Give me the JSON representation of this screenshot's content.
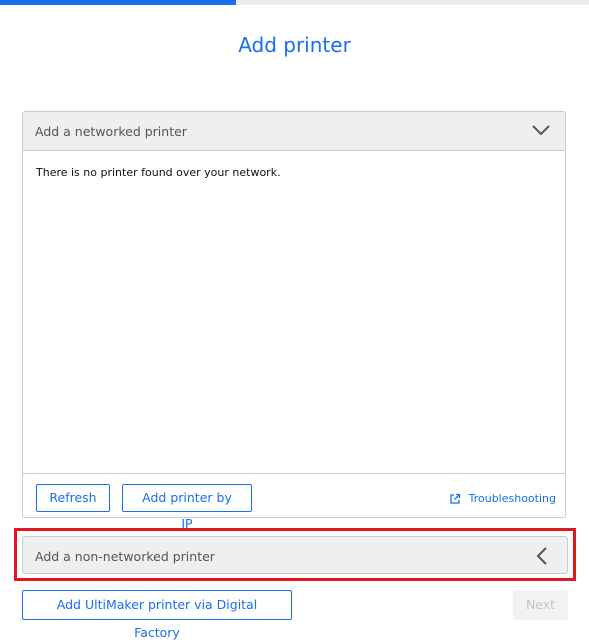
{
  "progress": {
    "fraction": 0.4
  },
  "title": "Add printer",
  "networked": {
    "header": "Add a networked printer",
    "empty_message": "There is no printer found over your network.",
    "refresh_label": "Refresh",
    "add_by_ip_label": "Add printer by IP",
    "troubleshooting_label": "Troubleshooting"
  },
  "non_networked": {
    "header": "Add a non-networked printer"
  },
  "footer": {
    "digital_factory_label": "Add UltiMaker printer via Digital Factory",
    "next_label": "Next"
  },
  "colors": {
    "accent": "#196ef0",
    "highlight": "#e5141e"
  },
  "icons": {
    "networked_toggle": "chevron-down-icon",
    "non_networked_toggle": "chevron-left-icon",
    "troubleshooting": "external-link-icon"
  }
}
